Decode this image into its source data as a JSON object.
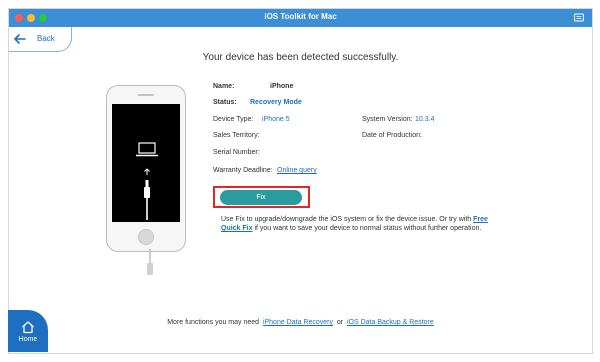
{
  "window": {
    "title": "iOS Toolkit for Mac"
  },
  "nav": {
    "back_label": "Back",
    "home_label": "Home"
  },
  "main": {
    "message": "Your device has been detected successfully."
  },
  "device": {
    "name_label": "Name:",
    "name_value": "iPhone",
    "status_label": "Status:",
    "status_value": "Recovery Mode",
    "device_type_label": "Device Type:",
    "device_type_value": "iPhone 5",
    "system_version_label": "System Version:",
    "system_version_value": "10.3.4",
    "sales_territory_label": "Sales Territory:",
    "date_of_production_label": "Date of Production:",
    "serial_number_label": "Serial Number:",
    "warranty_label": "Warranty Deadline:",
    "warranty_link": "Online query"
  },
  "fix": {
    "button_label": "Fix",
    "desc_part1": "Use Fix to upgrade/downgrade the iOS system or fix the device issue. Or try with",
    "desc_link": "Free Quick Fix",
    "desc_part2": "if you want to save your device to normal status without further operation."
  },
  "footer": {
    "prefix": "More functions you may need",
    "link1": "iPhone Data Recovery",
    "separator": "or",
    "link2": "iOS Data Backup & Restore"
  },
  "colors": {
    "titlebar": "#3c8fd6",
    "accent": "#1e6fbf",
    "fix_button": "#2a9c9f",
    "highlight": "#e1262b",
    "status_value": "#1e6fbf"
  },
  "icons": [
    "menu-icon",
    "back-arrow-icon",
    "laptop-icon",
    "up-arrow-icon",
    "lightning-cable-icon",
    "home-icon"
  ]
}
